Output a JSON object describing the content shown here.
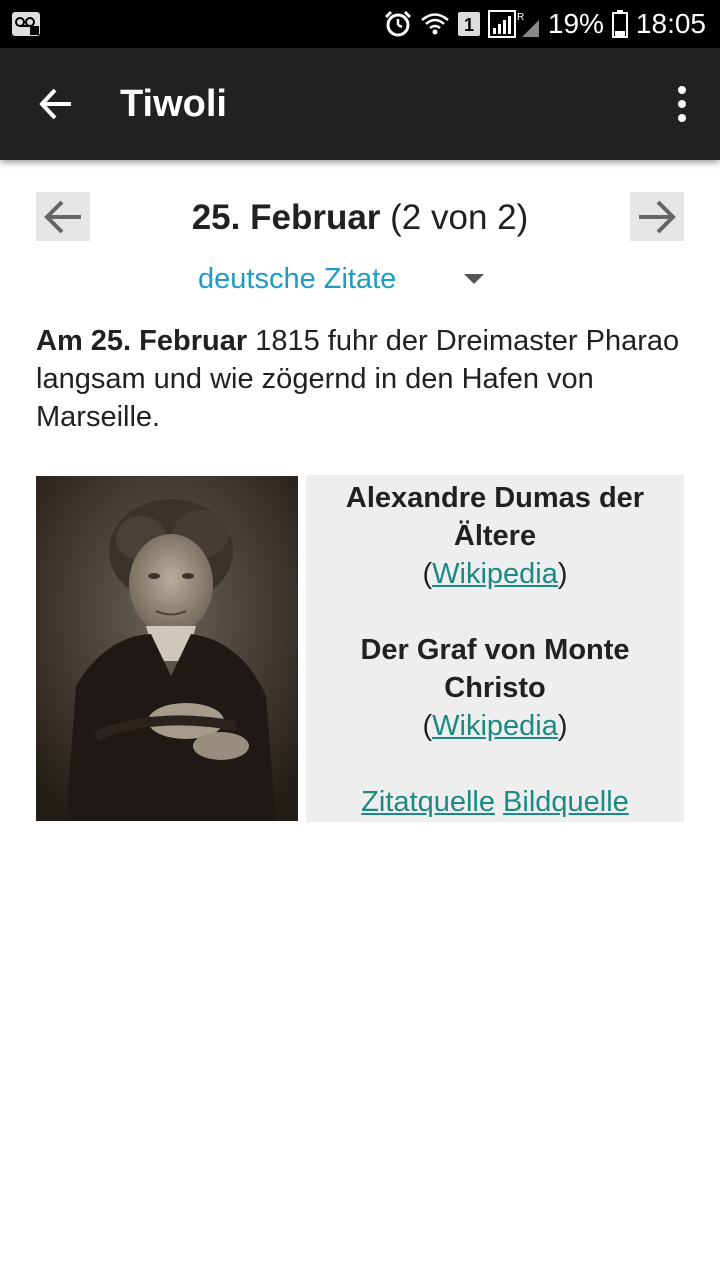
{
  "status_bar": {
    "battery_percent": "19%",
    "time": "18:05",
    "sim_slot": "1",
    "network_indicator": "R",
    "icons": [
      "voicemail-icon",
      "alarm-icon",
      "wifi-icon",
      "sim-icon",
      "signal-icon",
      "battery-icon"
    ]
  },
  "app_bar": {
    "title": "Tiwoli",
    "back_icon": "arrow-left-icon",
    "menu_icon": "more-vert-icon"
  },
  "date_nav": {
    "date_bold": "25. Februar",
    "counter": "(2 von 2)",
    "prev_icon": "arrow-left-icon",
    "next_icon": "arrow-right-icon"
  },
  "language_select": {
    "value": "deutsche Zitate"
  },
  "quote": {
    "lead_bold": "Am 25. Februar",
    "text": "1815 fuhr der Dreimaster Pharao langsam und wie zögernd in den Hafen von Marseille."
  },
  "info": {
    "author": "Alexandre Dumas der Ältere",
    "author_link": "Wikipedia",
    "work": "Der Graf von Monte Christo",
    "work_link": "Wikipedia",
    "quote_source": "Zitatquelle",
    "image_source": "Bildquelle",
    "paren_open": "(",
    "paren_close": ")"
  },
  "colors": {
    "app_bar": "#212121",
    "accent_link": "#1a8a82",
    "select_text": "#1f9bc4",
    "info_background": "#eeeeee"
  }
}
